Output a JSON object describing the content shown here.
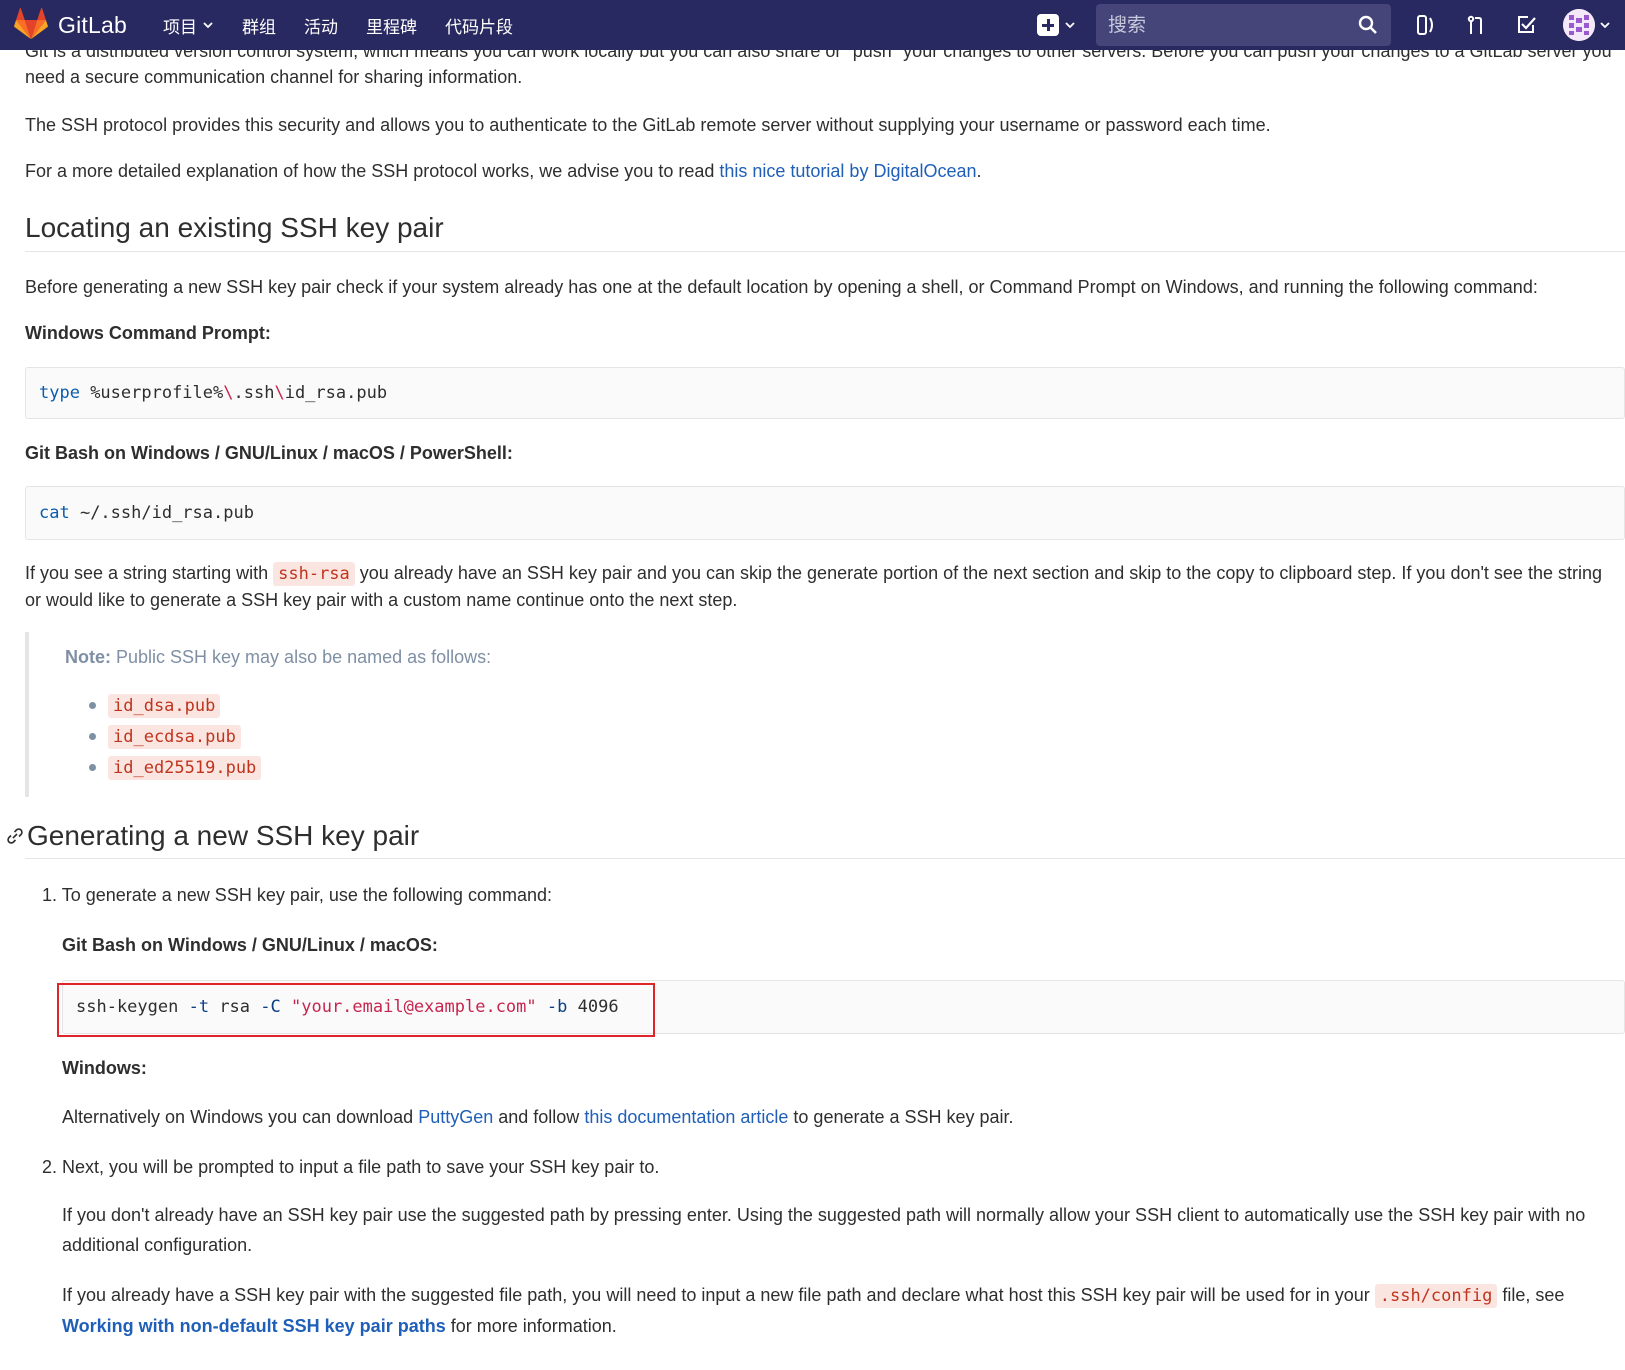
{
  "navbar": {
    "brand": "GitLab",
    "links": [
      "项目",
      "群组",
      "活动",
      "里程碑",
      "代码片段"
    ],
    "search_placeholder": "搜索"
  },
  "content": {
    "intro_top": "Git is a distributed version control system, which means you can work locally but you can also share or \"push\" your changes to other servers. Before you can push your changes to a GitLab server you need a secure communication channel for sharing information.",
    "ssh_protocol": "The SSH protocol provides this security and allows you to authenticate to the GitLab remote server without supplying your username or password each time.",
    "more_prefix": "For a more detailed explanation of how the SSH protocol works, we advise you to read ",
    "more_link": "this nice tutorial by DigitalOcean",
    "more_suffix": ".",
    "locate_heading": "Locating an existing SSH key pair",
    "before_text": "Before generating a new SSH key pair check if your system already has one at the default location by opening a shell, or Command Prompt on Windows, and running the following command:",
    "win_cmd_label": "Windows Command Prompt:",
    "win_cmd": {
      "kw": "type",
      "a": " %userprofile%",
      "e1": "\\",
      "b": ".ssh",
      "e2": "\\",
      "c": "id_rsa.pub"
    },
    "gitbash_label": "Git Bash on Windows / GNU/Linux / macOS / PowerShell:",
    "gitbash_cmd": {
      "kw": "cat",
      "rest": " ~/.ssh/id_rsa.pub"
    },
    "ifsee_prefix": "If you see a string starting with ",
    "ifsee_code": "ssh-rsa",
    "ifsee_suffix": " you already have an SSH key pair and you can skip the generate portion of the next section and skip to the copy to clipboard step. If you don't see the string or would like to generate a SSH key pair with a custom name continue onto the next step.",
    "note_label": "Note:",
    "note_text": " Public SSH key may also be named as follows:",
    "note_items": [
      "id_dsa.pub",
      "id_ecdsa.pub",
      "id_ed25519.pub"
    ],
    "gen_heading": "Generating a new SSH key pair",
    "step1_num": "1.",
    "step1_text": "To generate a new SSH key pair, use the following command:",
    "gitbash2_label": "Git Bash on Windows / GNU/Linux / macOS:",
    "keygen_cmd": {
      "a": "ssh-keygen ",
      "f1": "-t",
      "b": " rsa ",
      "f2": "-C",
      "c": " ",
      "s": "\"your.email@example.com\"",
      "d": " ",
      "f3": "-b",
      "e": " 4096"
    },
    "windows_label": "Windows:",
    "alt_prefix": "Alternatively on Windows you can download ",
    "alt_link1": "PuttyGen",
    "alt_mid": " and follow ",
    "alt_link2": "this documentation article",
    "alt_suffix": " to generate a SSH key pair.",
    "step2_num": "2.",
    "step2_text": "Next, you will be prompted to input a file path to save your SSH key pair to.",
    "ifdont_text": "If you don't already have an SSH key pair use the suggested path by pressing enter. Using the suggested path will normally allow your SSH client to automatically use the SSH key pair with no additional configuration.",
    "ifalready_prefix": "If you already have a SSH key pair with the suggested file path, you will need to input a new file path and declare what host this SSH key pair will be used for in your ",
    "ifalready_code": ".ssh/config",
    "ifalready_suffix": " file, see ",
    "ifalready_link": "Working with non-default SSH key pair paths",
    "ifalready_end": " for more information."
  }
}
